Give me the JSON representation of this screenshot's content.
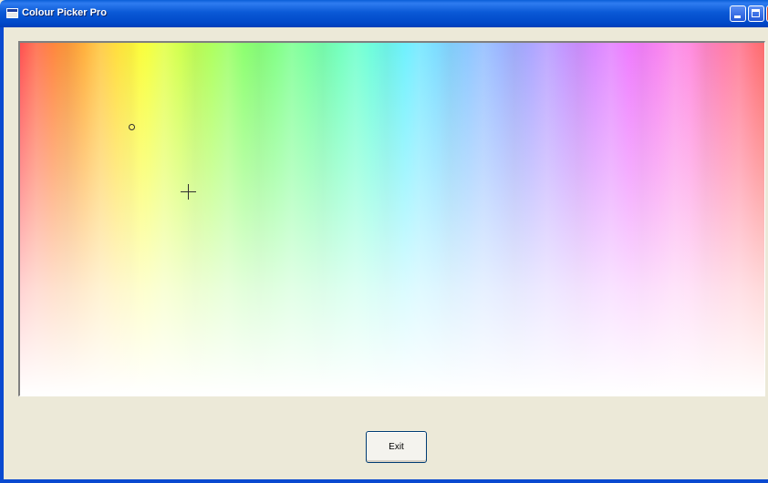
{
  "window": {
    "title": "Colour Picker Pro",
    "icon": "app-icon",
    "controls": [
      "minimize-icon",
      "maximize-icon",
      "close-icon"
    ]
  },
  "palette": {
    "markers": [
      "selection-circle-marker",
      "crosshair-cursor"
    ]
  },
  "buttons": {
    "exit_label": "Exit"
  },
  "colors": {
    "titlebar": "#0a59d6",
    "window_background": "#ece9d8",
    "button_border": "#003c74"
  }
}
